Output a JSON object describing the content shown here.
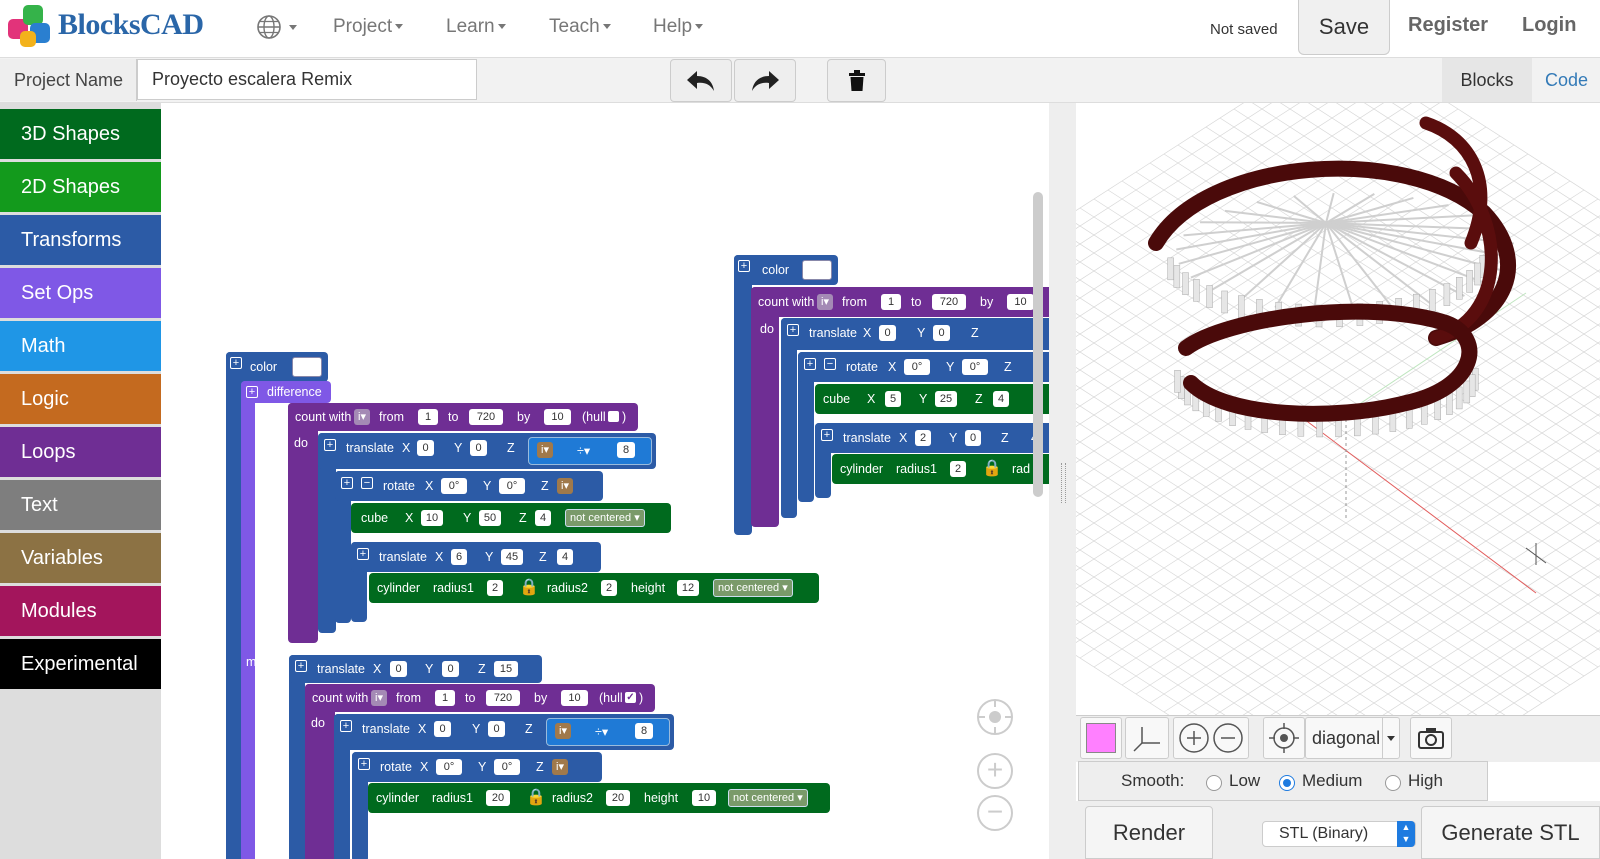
{
  "app": {
    "brand": "BlocksCAD"
  },
  "nav": {
    "project": "Project",
    "learn": "Learn",
    "teach": "Teach",
    "help": "Help",
    "status": "Not saved",
    "save": "Save",
    "register": "Register",
    "login": "Login"
  },
  "project": {
    "name_label": "Project Name",
    "name_value": "Proyecto escalera Remix"
  },
  "tabs": {
    "blocks": "Blocks",
    "code": "Code"
  },
  "toolbox": [
    {
      "label": "3D Shapes",
      "color": "#006a1e"
    },
    {
      "label": "2D Shapes",
      "color": "#139a1c"
    },
    {
      "label": "Transforms",
      "color": "#2c5ba6"
    },
    {
      "label": "Set Ops",
      "color": "#7f58e6"
    },
    {
      "label": "Math",
      "color": "#1f96e6"
    },
    {
      "label": "Logic",
      "color": "#c46a1f"
    },
    {
      "label": "Loops",
      "color": "#6f2e94"
    },
    {
      "label": "Text",
      "color": "#7e7e7e"
    },
    {
      "label": "Variables",
      "color": "#8c7244"
    },
    {
      "label": "Modules",
      "color": "#a3155c"
    },
    {
      "label": "Experimental",
      "color": "#000000"
    }
  ],
  "blocks": {
    "color": "color",
    "difference": "difference",
    "count_with": "count with",
    "var_i": "i",
    "from": "from",
    "to": "to",
    "by": "by",
    "hull": "(hull",
    "hull_close": ")",
    "do": "do",
    "minus": "minus",
    "translate": "translate",
    "rotate": "rotate",
    "cube": "cube",
    "cylinder": "cylinder",
    "radius1": "radius1",
    "radius2": "radius2",
    "height": "height",
    "not_centered": "not centered",
    "x": "X",
    "y": "Y",
    "z": "Z",
    "div_op": "÷",
    "n_0": "0",
    "n_1": "1",
    "n_2": "2",
    "n_4": "4",
    "n_5": "5",
    "n_6": "6",
    "n_8": "8",
    "n_10": "10",
    "n_12": "12",
    "n_15": "15",
    "n_20": "20",
    "n_25": "25",
    "n_45": "45",
    "n_50": "50",
    "n_720": "720",
    "deg_0": "0°",
    "n_4_cut": "4",
    "n_10_cut": "10",
    "rad_cut": "rad"
  },
  "viewer": {
    "view_mode": "diagonal",
    "smooth_label": "Smooth:",
    "smooth_low": "Low",
    "smooth_medium": "Medium",
    "smooth_high": "High",
    "smooth_selected": "Medium",
    "render": "Render",
    "format": "STL (Binary)",
    "generate": "Generate STL",
    "swatch_color": "#ff80ff"
  },
  "colors": {
    "transform_blue": "#2c5ba6",
    "loop_purple": "#6f2e94",
    "setop_purple": "#7f58e6",
    "shape_green": "#006a1e",
    "link_blue": "#337ab7",
    "helix_dark": "#4a0a0a"
  }
}
